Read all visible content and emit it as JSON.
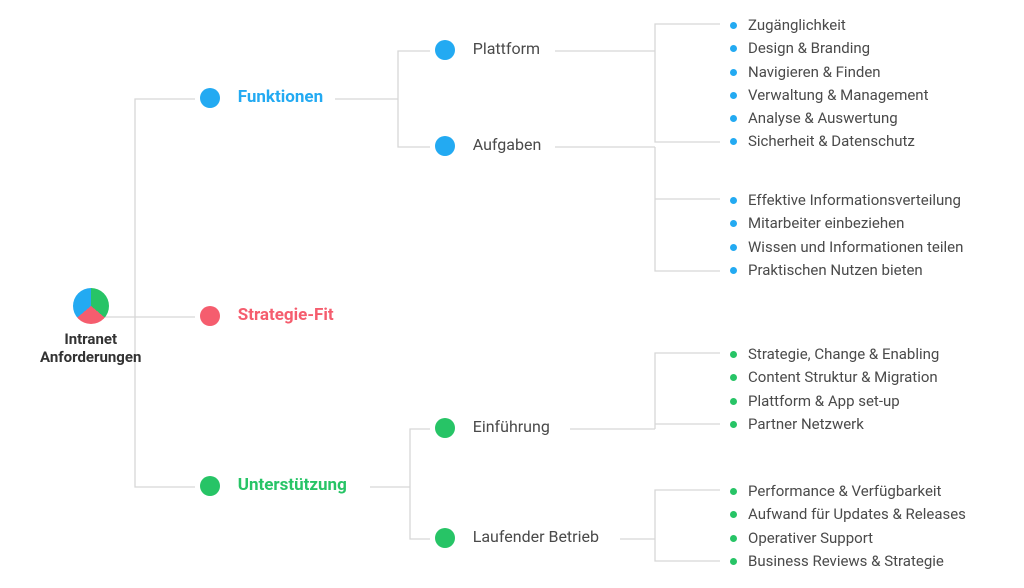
{
  "root": {
    "line1": "Intranet",
    "line2": "Anforderungen"
  },
  "branches": {
    "funktionen": {
      "label": "Funktionen",
      "children": {
        "plattform": {
          "label": "Plattform",
          "items": [
            "Zugänglichkeit",
            "Design & Branding",
            "Navigieren & Finden",
            "Verwaltung & Management",
            "Analyse & Auswertung",
            "Sicherheit & Datenschutz"
          ]
        },
        "aufgaben": {
          "label": "Aufgaben",
          "items": [
            "Effektive Informationsverteilung",
            "Mitarbeiter einbeziehen",
            "Wissen und Informationen teilen",
            "Praktischen Nutzen bieten"
          ]
        }
      }
    },
    "strategie": {
      "label": "Strategie-Fit"
    },
    "unterstuetzung": {
      "label": "Unterstützung",
      "children": {
        "einfuehrung": {
          "label": "Einführung",
          "items": [
            "Strategie, Change & Enabling",
            "Content Struktur & Migration",
            "Plattform & App set-up",
            "Partner Netzwerk"
          ]
        },
        "betrieb": {
          "label": "Laufender Betrieb",
          "items": [
            "Performance & Verfügbarkeit",
            "Aufwand für Updates & Releases",
            "Operativer Support",
            "Business Reviews & Strategie"
          ]
        }
      }
    }
  },
  "chart_data": {
    "type": "tree",
    "title": "Intranet Anforderungen",
    "root": "Intranet Anforderungen",
    "nodes": [
      {
        "name": "Funktionen",
        "color": "#23aaf2",
        "children": [
          {
            "name": "Plattform",
            "children": [
              "Zugänglichkeit",
              "Design & Branding",
              "Navigieren & Finden",
              "Verwaltung & Management",
              "Analyse & Auswertung",
              "Sicherheit & Datenschutz"
            ]
          },
          {
            "name": "Aufgaben",
            "children": [
              "Effektive Informationsverteilung",
              "Mitarbeiter einbeziehen",
              "Wissen und Informationen teilen",
              "Praktischen Nutzen bieten"
            ]
          }
        ]
      },
      {
        "name": "Strategie-Fit",
        "color": "#f55d6e",
        "children": []
      },
      {
        "name": "Unterstützung",
        "color": "#27c466",
        "children": [
          {
            "name": "Einführung",
            "children": [
              "Strategie, Change & Enabling",
              "Content Struktur & Migration",
              "Plattform & App set-up",
              "Partner Netzwerk"
            ]
          },
          {
            "name": "Laufender Betrieb",
            "children": [
              "Performance & Verfügbarkeit",
              "Aufwand für Updates & Releases",
              "Operativer Support",
              "Business Reviews & Strategie"
            ]
          }
        ]
      }
    ]
  }
}
